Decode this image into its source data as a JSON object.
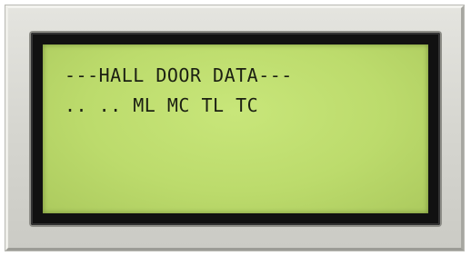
{
  "display": {
    "lines": [
      "---HALL DOOR DATA---",
      ".. .. ML MC TL TC"
    ]
  },
  "colors": {
    "screen_background": "#bcdb6c",
    "text": "#1b1f12",
    "bezel": "#d6d6d0",
    "frame": "#111111"
  }
}
